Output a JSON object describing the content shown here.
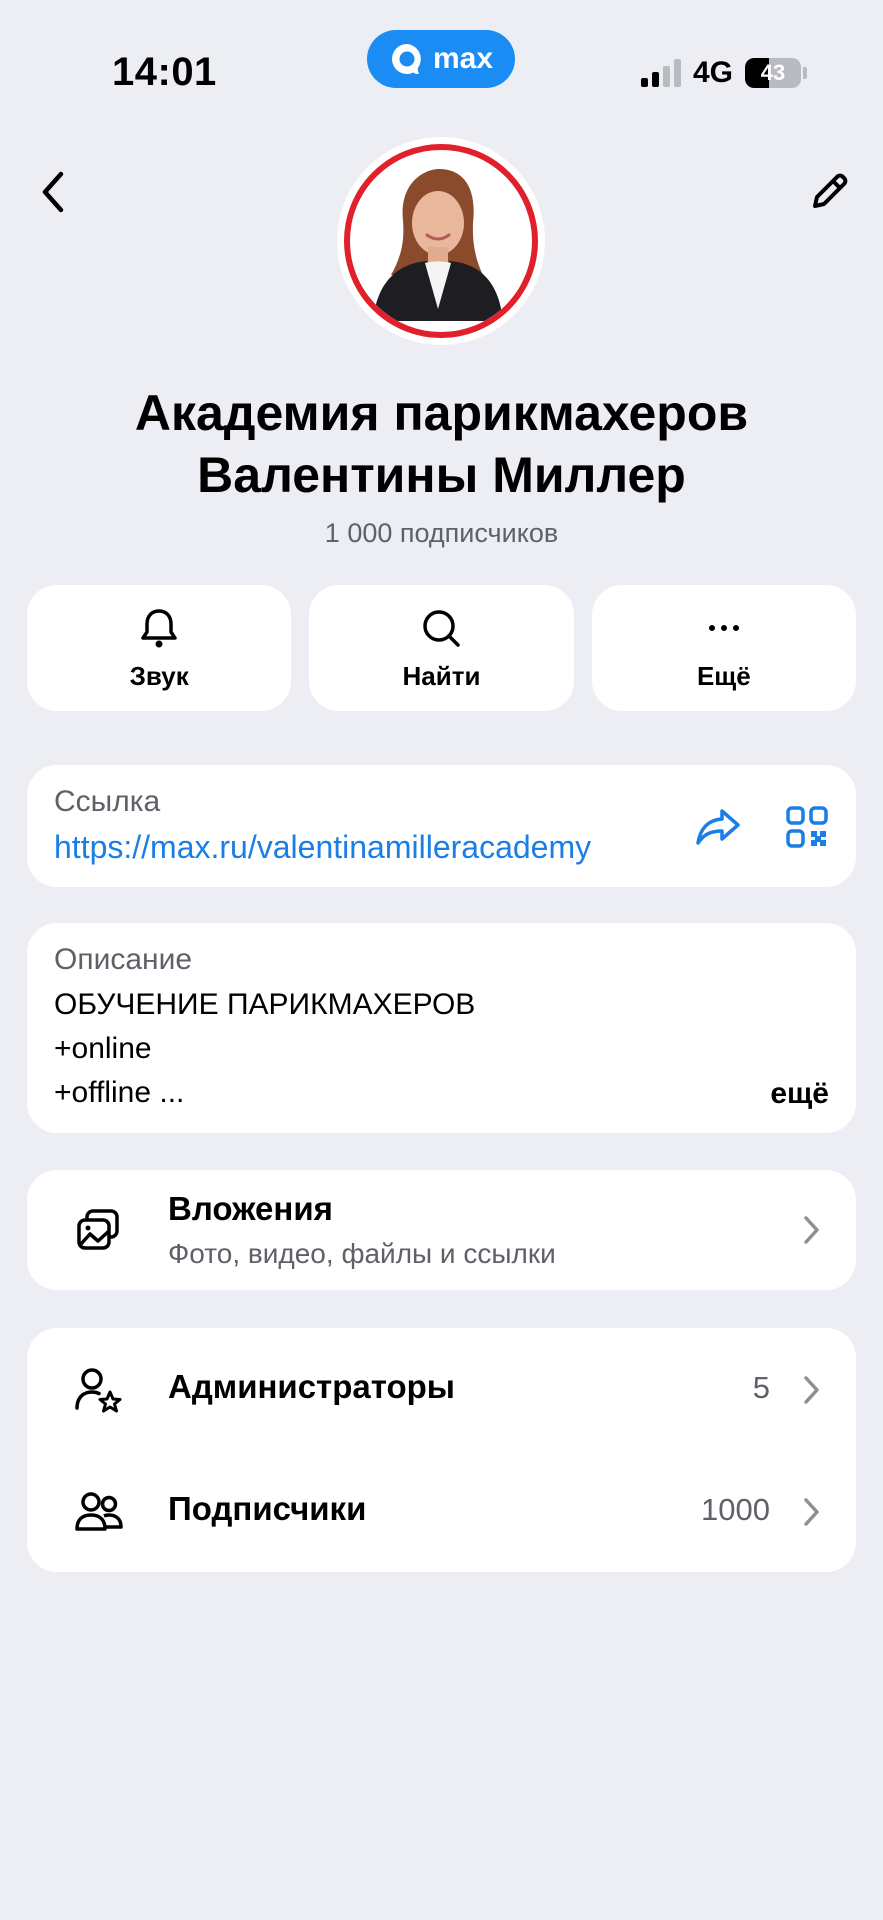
{
  "status_bar": {
    "time": "14:01",
    "app_label": "max",
    "network": "4G",
    "battery": "43",
    "battery_level": 0.43
  },
  "header": {
    "back_icon": "chevron-left-icon",
    "edit_icon": "pencil-icon"
  },
  "profile": {
    "title_line1": "Академия парикмахеров",
    "title_line2": "Валентины Миллер",
    "subscribers": "1 000 подписчиков"
  },
  "actions": [
    {
      "label": "Звук",
      "icon": "bell-icon"
    },
    {
      "label": "Найти",
      "icon": "search-icon"
    },
    {
      "label": "Ещё",
      "icon": "more-icon"
    }
  ],
  "link": {
    "caption": "Ссылка",
    "url": "https://max.ru/valentinamilleracademy"
  },
  "description": {
    "caption": "Описание",
    "lines": [
      "ОБУЧЕНИЕ ПАРИКМАХЕРОВ",
      "+online",
      "+offline ..."
    ],
    "more": "ещё"
  },
  "attachments": {
    "title": "Вложения",
    "subtitle": "Фото, видео, файлы и ссылки"
  },
  "members": [
    {
      "title": "Администраторы",
      "count": "5"
    },
    {
      "title": "Подписчики",
      "count": "1000"
    }
  ],
  "colors": {
    "background": "#eceef3",
    "accent": "#1a7ee6",
    "avatar_ring": "#e0202a"
  }
}
